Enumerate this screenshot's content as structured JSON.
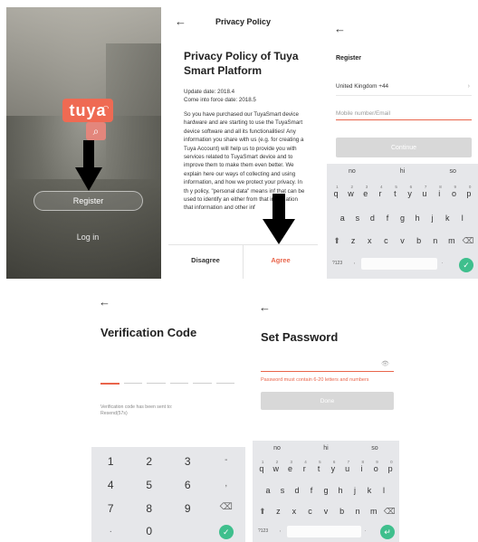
{
  "splash": {
    "logo_text": "tuya",
    "register_label": "Register",
    "login_label": "Log in"
  },
  "privacy": {
    "back_icon": "←",
    "nav_title": "Privacy Policy",
    "doc_title": "Privacy Policy of Tuya Smart Platform",
    "update_date": "Update date: 2018.4",
    "effective_date": "Come into force date: 2018.5",
    "body": "So you have purchased our TuyaSmart device hardware and are starting to use the TuyaSmart device software and all its functionalities! Any information you share with us (e.g. for creating a Tuya Account) will help us to provide you with services related to TuyaSmart device and to improve them to make them even better. We explain here our ways of collecting and using information, and how we protect your privacy. In th         y policy, \"personal data\" means inf          that can be used to identify an         either from that information          that information and other inf",
    "disagree_label": "Disagree",
    "agree_label": "Agree"
  },
  "register": {
    "back_icon": "←",
    "heading": "Register",
    "country": "United Kingdom +44",
    "country_chevron": "›",
    "mobile_placeholder": "Mobile number/Email",
    "continue_label": "Continue"
  },
  "keyboard_full": {
    "suggestions": [
      "no",
      "hi",
      "so"
    ],
    "row1": [
      "q",
      "w",
      "e",
      "r",
      "t",
      "y",
      "u",
      "i",
      "o",
      "p"
    ],
    "row1_nums": [
      "1",
      "2",
      "3",
      "4",
      "5",
      "6",
      "7",
      "8",
      "9",
      "0"
    ],
    "row2": [
      "a",
      "s",
      "d",
      "f",
      "g",
      "h",
      "j",
      "k",
      "l"
    ],
    "row3": [
      "z",
      "x",
      "c",
      "v",
      "b",
      "n",
      "m"
    ],
    "shift": "⬆",
    "backspace": "⌫",
    "sym_label": "?123",
    "comma": ",",
    "period": ".",
    "ok": "✓",
    "enter": "↵"
  },
  "verification": {
    "back_icon": "←",
    "title": "Verification Code",
    "sent_text": "Verification code has been sent to:",
    "resend_text": "Resend(57s)",
    "numpad": {
      "row1": [
        "1",
        "2",
        "3",
        "-"
      ],
      "row2": [
        "4",
        "5",
        "6",
        ","
      ],
      "row3": [
        "7",
        "8",
        "9",
        "⌫"
      ],
      "row4": [
        ".",
        "0",
        "",
        "✓"
      ]
    }
  },
  "set_password": {
    "back_icon": "←",
    "title": "Set Password",
    "eye_icon": "👁",
    "hint": "Password must contain 6-20 letters and numbers",
    "done_label": "Done"
  },
  "colors": {
    "accent": "#e9654b",
    "brand": "#ef6a53",
    "ok_green": "#3fbf8d",
    "disabled_button": "#d8d8d8"
  }
}
